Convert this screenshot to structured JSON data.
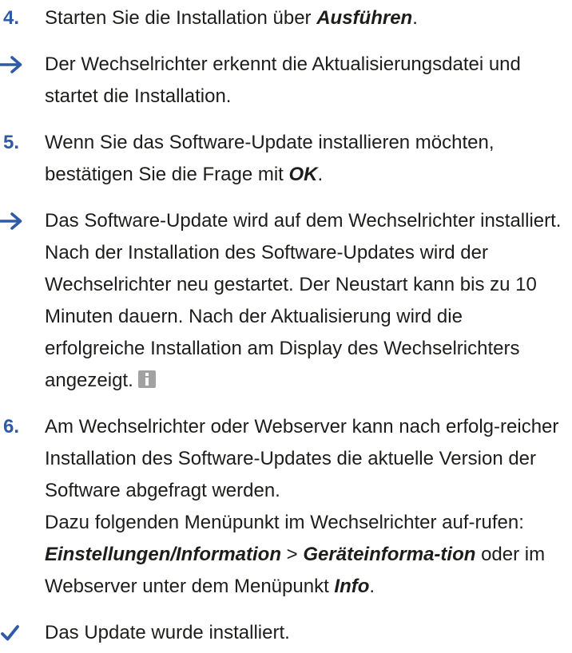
{
  "step4": {
    "number": "4.",
    "text_before": "Starten Sie die Installation über ",
    "emphasis": "Ausführen",
    "text_after": "."
  },
  "result4": {
    "icon": "arrow-right-icon",
    "text": "Der Wechselrichter erkennt die Aktualisierungsdatei und startet die Installation."
  },
  "step5": {
    "number": "5.",
    "text_before": "Wenn Sie das Software-Update installieren möchten, bestätigen Sie die Frage mit ",
    "emphasis": "OK",
    "text_after": "."
  },
  "result5": {
    "icon": "arrow-right-icon",
    "text": "Das Software-Update wird auf dem Wechselrichter installiert. Nach der Installation des Software-Updates wird der Wechselrichter neu gestartet. Der Neustart kann bis zu 10 Minuten dauern. Nach der Aktualisierung wird die erfolgreiche Installation am Display des Wechselrichters angezeigt.",
    "info_icon": "info-icon"
  },
  "step6": {
    "number": "6.",
    "line1_before": "Am Wechselrichter oder Webserver kann nach erfolg-reicher Installation des Software-Updates die aktuelle Version der Software abgefragt werden.",
    "line2_before": "Dazu folgenden Menüpunkt im Wechselrichter auf-rufen: ",
    "emph1": "Einstellungen/Information",
    "sep": " > ",
    "emph2": "Geräteinforma-tion",
    "mid": " oder im Webserver unter dem Menüpunkt ",
    "emph3": "Info",
    "end": "."
  },
  "done": {
    "icon": "checkmark-icon",
    "text": "Das Update wurde installiert."
  },
  "colors": {
    "accent": "#2f5aa8",
    "text": "#1d1d1b",
    "info_icon": "#a2a2a2"
  }
}
